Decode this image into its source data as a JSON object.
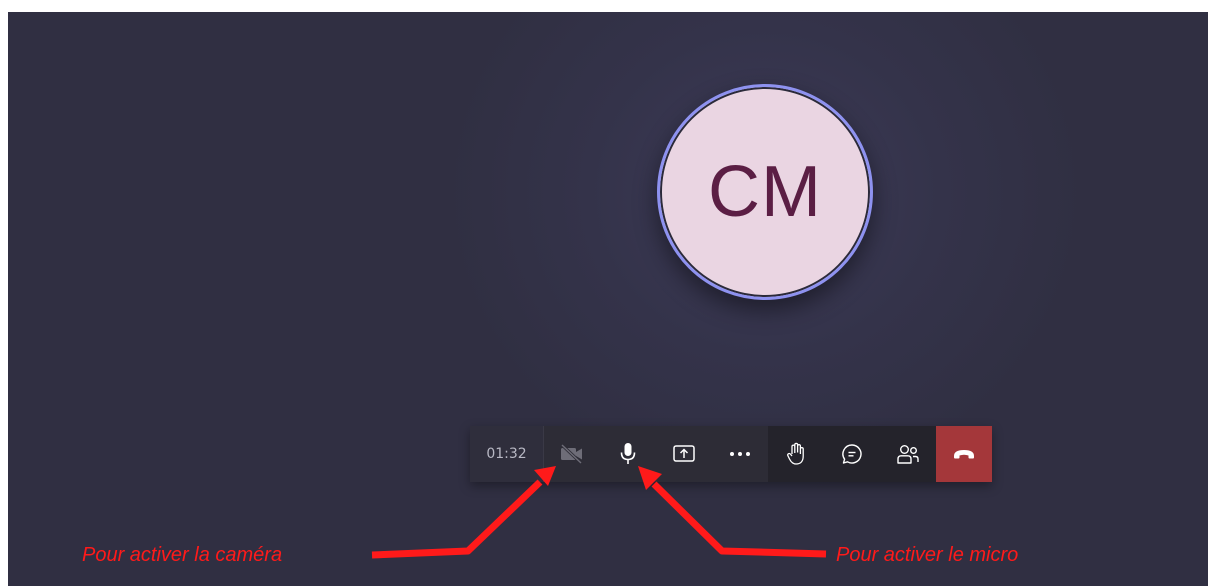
{
  "meeting": {
    "participant_initials": "CM",
    "avatar_bg": "#ead5e2",
    "avatar_ring": "#8e92f0",
    "avatar_text_color": "#5b1e44"
  },
  "toolbar": {
    "timer": "01:32",
    "buttons": [
      {
        "name": "camera-off-icon",
        "title": "Camera off"
      },
      {
        "name": "microphone-icon",
        "title": "Microphone"
      },
      {
        "name": "share-screen-icon",
        "title": "Share"
      },
      {
        "name": "more-actions-icon",
        "title": "More actions"
      },
      {
        "name": "raise-hand-icon",
        "title": "Raise hand"
      },
      {
        "name": "chat-icon",
        "title": "Chat"
      },
      {
        "name": "participants-icon",
        "title": "Participants"
      },
      {
        "name": "hang-up-icon",
        "title": "Leave"
      }
    ],
    "hangup_color": "#a4373a"
  },
  "annotations": {
    "camera_label": "Pour activer la caméra",
    "mic_label": "Pour activer le micro",
    "color": "#ff1a1a"
  }
}
